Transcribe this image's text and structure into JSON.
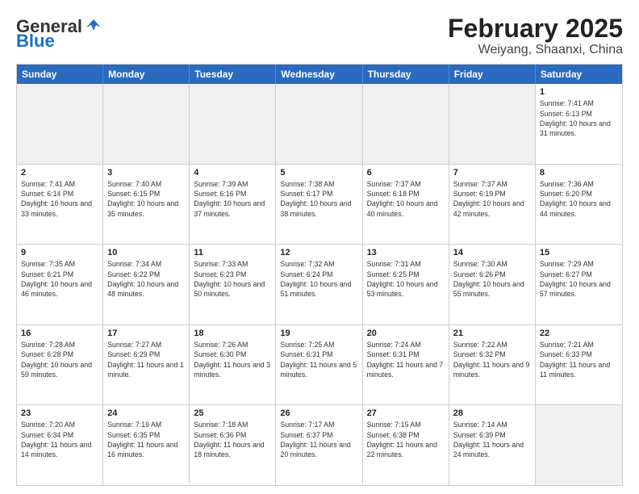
{
  "header": {
    "logo_general": "General",
    "logo_blue": "Blue",
    "month_title": "February 2025",
    "location": "Weiyang, Shaanxi, China"
  },
  "days_of_week": [
    "Sunday",
    "Monday",
    "Tuesday",
    "Wednesday",
    "Thursday",
    "Friday",
    "Saturday"
  ],
  "rows": [
    [
      {
        "day": "",
        "info": "",
        "shaded": true
      },
      {
        "day": "",
        "info": "",
        "shaded": true
      },
      {
        "day": "",
        "info": "",
        "shaded": true
      },
      {
        "day": "",
        "info": "",
        "shaded": true
      },
      {
        "day": "",
        "info": "",
        "shaded": true
      },
      {
        "day": "",
        "info": "",
        "shaded": true
      },
      {
        "day": "1",
        "info": "Sunrise: 7:41 AM\nSunset: 6:13 PM\nDaylight: 10 hours and 31 minutes.",
        "shaded": false
      }
    ],
    [
      {
        "day": "2",
        "info": "Sunrise: 7:41 AM\nSunset: 6:14 PM\nDaylight: 10 hours and 33 minutes.",
        "shaded": false
      },
      {
        "day": "3",
        "info": "Sunrise: 7:40 AM\nSunset: 6:15 PM\nDaylight: 10 hours and 35 minutes.",
        "shaded": false
      },
      {
        "day": "4",
        "info": "Sunrise: 7:39 AM\nSunset: 6:16 PM\nDaylight: 10 hours and 37 minutes.",
        "shaded": false
      },
      {
        "day": "5",
        "info": "Sunrise: 7:38 AM\nSunset: 6:17 PM\nDaylight: 10 hours and 38 minutes.",
        "shaded": false
      },
      {
        "day": "6",
        "info": "Sunrise: 7:37 AM\nSunset: 6:18 PM\nDaylight: 10 hours and 40 minutes.",
        "shaded": false
      },
      {
        "day": "7",
        "info": "Sunrise: 7:37 AM\nSunset: 6:19 PM\nDaylight: 10 hours and 42 minutes.",
        "shaded": false
      },
      {
        "day": "8",
        "info": "Sunrise: 7:36 AM\nSunset: 6:20 PM\nDaylight: 10 hours and 44 minutes.",
        "shaded": false
      }
    ],
    [
      {
        "day": "9",
        "info": "Sunrise: 7:35 AM\nSunset: 6:21 PM\nDaylight: 10 hours and 46 minutes.",
        "shaded": false
      },
      {
        "day": "10",
        "info": "Sunrise: 7:34 AM\nSunset: 6:22 PM\nDaylight: 10 hours and 48 minutes.",
        "shaded": false
      },
      {
        "day": "11",
        "info": "Sunrise: 7:33 AM\nSunset: 6:23 PM\nDaylight: 10 hours and 50 minutes.",
        "shaded": false
      },
      {
        "day": "12",
        "info": "Sunrise: 7:32 AM\nSunset: 6:24 PM\nDaylight: 10 hours and 51 minutes.",
        "shaded": false
      },
      {
        "day": "13",
        "info": "Sunrise: 7:31 AM\nSunset: 6:25 PM\nDaylight: 10 hours and 53 minutes.",
        "shaded": false
      },
      {
        "day": "14",
        "info": "Sunrise: 7:30 AM\nSunset: 6:26 PM\nDaylight: 10 hours and 55 minutes.",
        "shaded": false
      },
      {
        "day": "15",
        "info": "Sunrise: 7:29 AM\nSunset: 6:27 PM\nDaylight: 10 hours and 57 minutes.",
        "shaded": false
      }
    ],
    [
      {
        "day": "16",
        "info": "Sunrise: 7:28 AM\nSunset: 6:28 PM\nDaylight: 10 hours and 59 minutes.",
        "shaded": false
      },
      {
        "day": "17",
        "info": "Sunrise: 7:27 AM\nSunset: 6:29 PM\nDaylight: 11 hours and 1 minute.",
        "shaded": false
      },
      {
        "day": "18",
        "info": "Sunrise: 7:26 AM\nSunset: 6:30 PM\nDaylight: 11 hours and 3 minutes.",
        "shaded": false
      },
      {
        "day": "19",
        "info": "Sunrise: 7:25 AM\nSunset: 6:31 PM\nDaylight: 11 hours and 5 minutes.",
        "shaded": false
      },
      {
        "day": "20",
        "info": "Sunrise: 7:24 AM\nSunset: 6:31 PM\nDaylight: 11 hours and 7 minutes.",
        "shaded": false
      },
      {
        "day": "21",
        "info": "Sunrise: 7:22 AM\nSunset: 6:32 PM\nDaylight: 11 hours and 9 minutes.",
        "shaded": false
      },
      {
        "day": "22",
        "info": "Sunrise: 7:21 AM\nSunset: 6:33 PM\nDaylight: 11 hours and 11 minutes.",
        "shaded": false
      }
    ],
    [
      {
        "day": "23",
        "info": "Sunrise: 7:20 AM\nSunset: 6:34 PM\nDaylight: 11 hours and 14 minutes.",
        "shaded": false
      },
      {
        "day": "24",
        "info": "Sunrise: 7:19 AM\nSunset: 6:35 PM\nDaylight: 11 hours and 16 minutes.",
        "shaded": false
      },
      {
        "day": "25",
        "info": "Sunrise: 7:18 AM\nSunset: 6:36 PM\nDaylight: 11 hours and 18 minutes.",
        "shaded": false
      },
      {
        "day": "26",
        "info": "Sunrise: 7:17 AM\nSunset: 6:37 PM\nDaylight: 11 hours and 20 minutes.",
        "shaded": false
      },
      {
        "day": "27",
        "info": "Sunrise: 7:15 AM\nSunset: 6:38 PM\nDaylight: 11 hours and 22 minutes.",
        "shaded": false
      },
      {
        "day": "28",
        "info": "Sunrise: 7:14 AM\nSunset: 6:39 PM\nDaylight: 11 hours and 24 minutes.",
        "shaded": false
      },
      {
        "day": "",
        "info": "",
        "shaded": true
      }
    ]
  ]
}
